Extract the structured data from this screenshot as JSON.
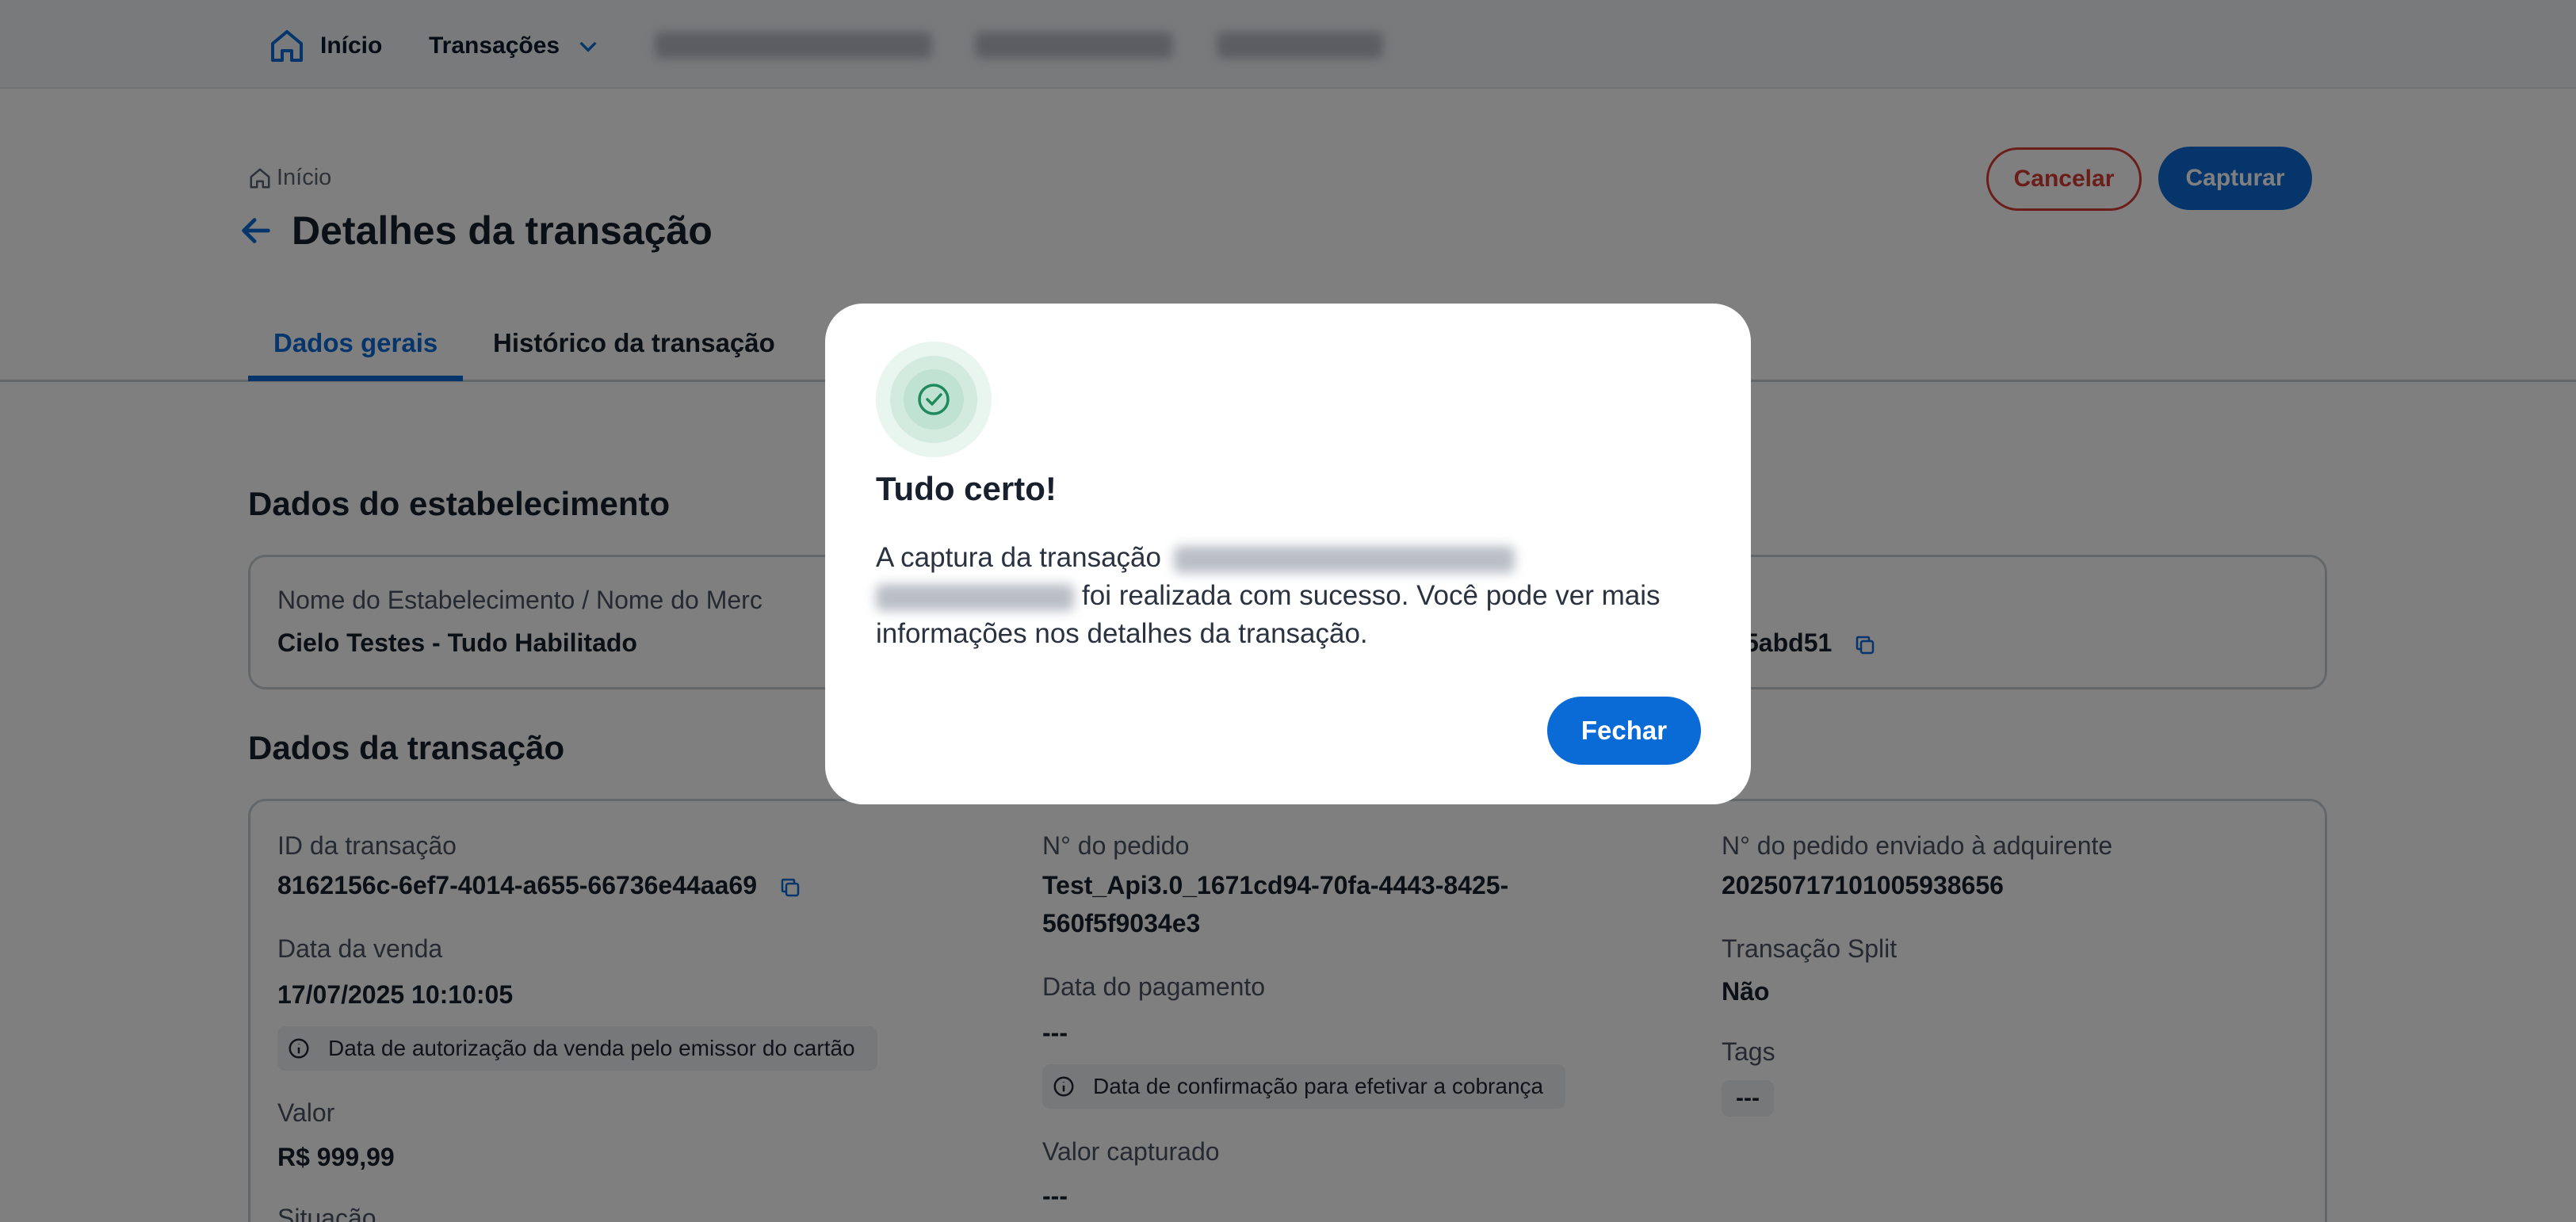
{
  "nav": {
    "home_label": "Início",
    "transactions_label": "Transações"
  },
  "header": {
    "breadcrumb": "Início",
    "title": "Detalhes da transação",
    "cancel_label": "Cancelar",
    "capture_label": "Capturar"
  },
  "tabs": [
    {
      "label": "Dados gerais",
      "active": true
    },
    {
      "label": "Histórico da transação",
      "active": false
    }
  ],
  "establishment": {
    "section_title": "Dados do estabelecimento",
    "name_label": "Nome do Estabelecimento / Nome do Merc",
    "name_value": "Cielo Testes - Tudo Habilitado",
    "id_fragment": "5abd51"
  },
  "transaction": {
    "section_title": "Dados da transação",
    "id_label": "ID da transação",
    "id_value": "8162156c-6ef7-4014-a655-66736e44aa69",
    "sale_date_label": "Data da venda",
    "sale_date_value": "17/07/2025 10:10:05",
    "sale_date_hint": "Data de autorização da venda pelo emissor do cartão",
    "amount_label": "Valor",
    "amount_value": "R$ 999,99",
    "status_label": "Situação",
    "order_label": "N° do pedido",
    "order_value": "Test_Api3.0_1671cd94-70fa-4443-8425-560f5f9034e3",
    "payment_date_label": "Data do pagamento",
    "payment_date_value": "---",
    "payment_date_hint": "Data de confirmação para efetivar a cobrança",
    "captured_label": "Valor capturado",
    "captured_value": "---",
    "acquirer_order_label": "N° do pedido enviado à adquirente",
    "acquirer_order_value": "20250717101005938656",
    "split_label": "Transação Split",
    "split_value": "Não",
    "tags_label": "Tags",
    "tags_value": "---"
  },
  "modal": {
    "title": "Tudo certo!",
    "text_prefix": "A captura da transação",
    "text_suffix": "foi realizada com sucesso. Você pode ver mais informações nos detalhes da transação.",
    "close_label": "Fechar"
  },
  "colors": {
    "primary": "#0a6ad6",
    "danger": "#d63b33",
    "success": "#1f8a5b"
  }
}
